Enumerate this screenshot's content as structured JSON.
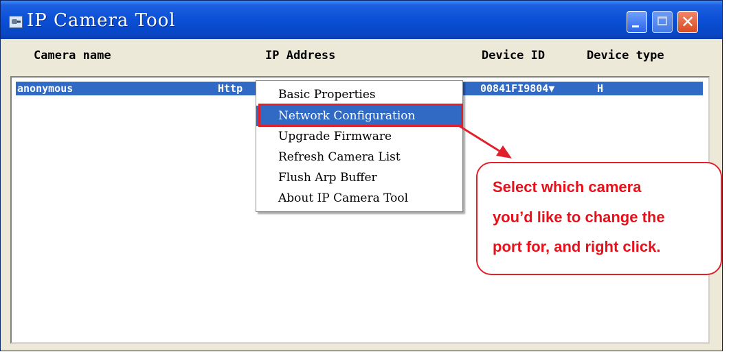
{
  "window": {
    "title": "IP Camera Tool",
    "icons": {
      "app": "camera-app-icon",
      "minimize": "minimize-icon",
      "maximize": "maximize-icon",
      "close": "close-icon"
    },
    "close_glyph": "✕"
  },
  "columns": [
    "Camera name",
    "IP Address",
    "Device ID",
    "Device type"
  ],
  "rows": [
    {
      "camera_name": "anonymous",
      "ip_address": "Http",
      "device_id": "00841FI9804▼",
      "device_type": "H",
      "selected": true
    }
  ],
  "context_menu": {
    "items": [
      "Basic Properties",
      "Network Configuration",
      "Upgrade Firmware",
      "Refresh Camera List",
      "Flush Arp Buffer",
      "About IP Camera Tool"
    ],
    "selected_index": 1
  },
  "callout": {
    "lines": [
      "Select which camera",
      "you’d like to change the",
      "port for, and right click."
    ],
    "color": "#e8101a"
  },
  "colors": {
    "titlebar": "#0a4fd6",
    "selection": "#316ac5",
    "annotation": "#e0202a"
  }
}
